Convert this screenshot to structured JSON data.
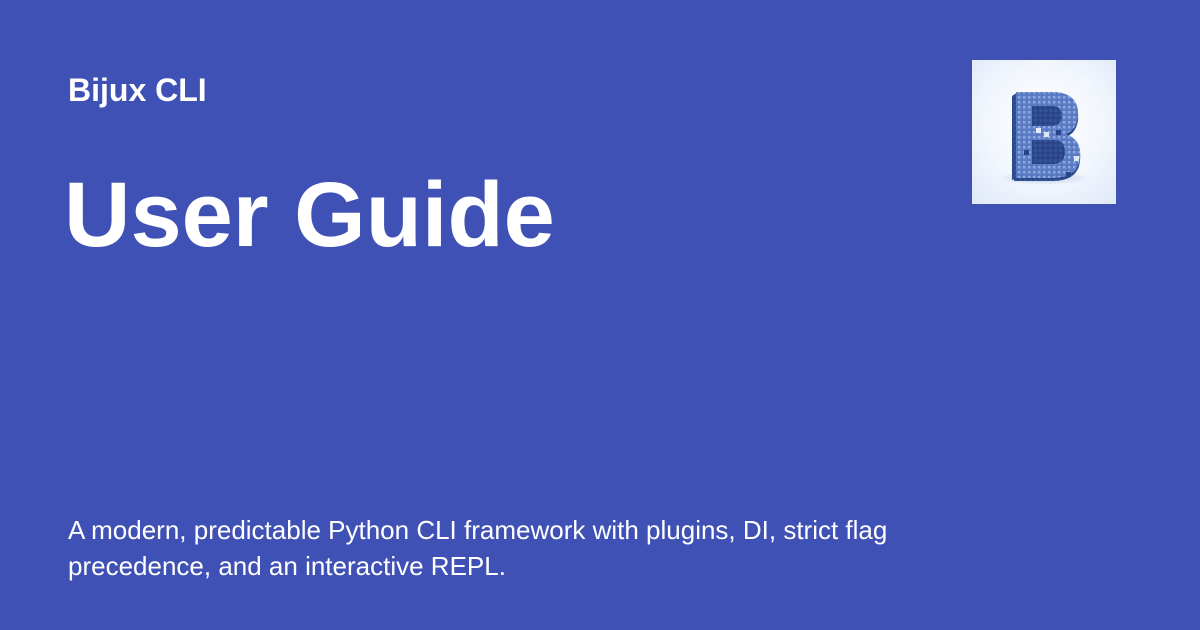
{
  "card": {
    "site_name": "Bijux CLI",
    "title": "User Guide",
    "description": "A modern, predictable Python CLI framework with plugins, DI, strict flag precedence, and an interactive REPL.",
    "logo_icon": "pixel-letter-b-icon",
    "background_color": "#3f51b5",
    "text_color": "#ffffff"
  }
}
